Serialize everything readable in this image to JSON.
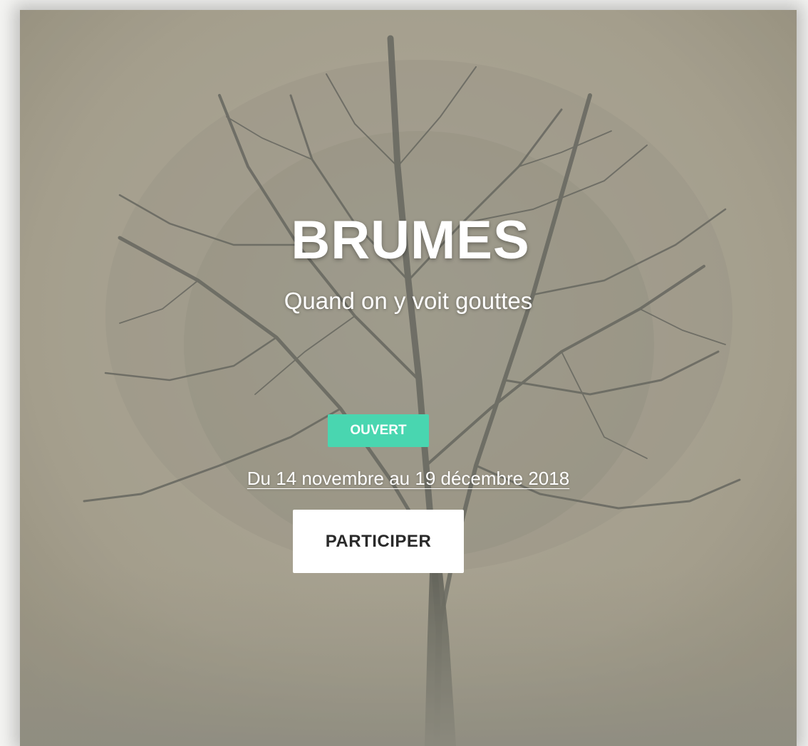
{
  "hero": {
    "title": "BRUMES",
    "subtitle": "Quand on y voit gouttes"
  },
  "status": {
    "label": "OUVERT",
    "color": "#49d6b0"
  },
  "dates": {
    "text": "Du 14 novembre au 19 décembre 2018"
  },
  "cta": {
    "label": "PARTICIPER"
  },
  "background": {
    "image": "foggy-tree-photo",
    "tint": "#a8a393"
  }
}
